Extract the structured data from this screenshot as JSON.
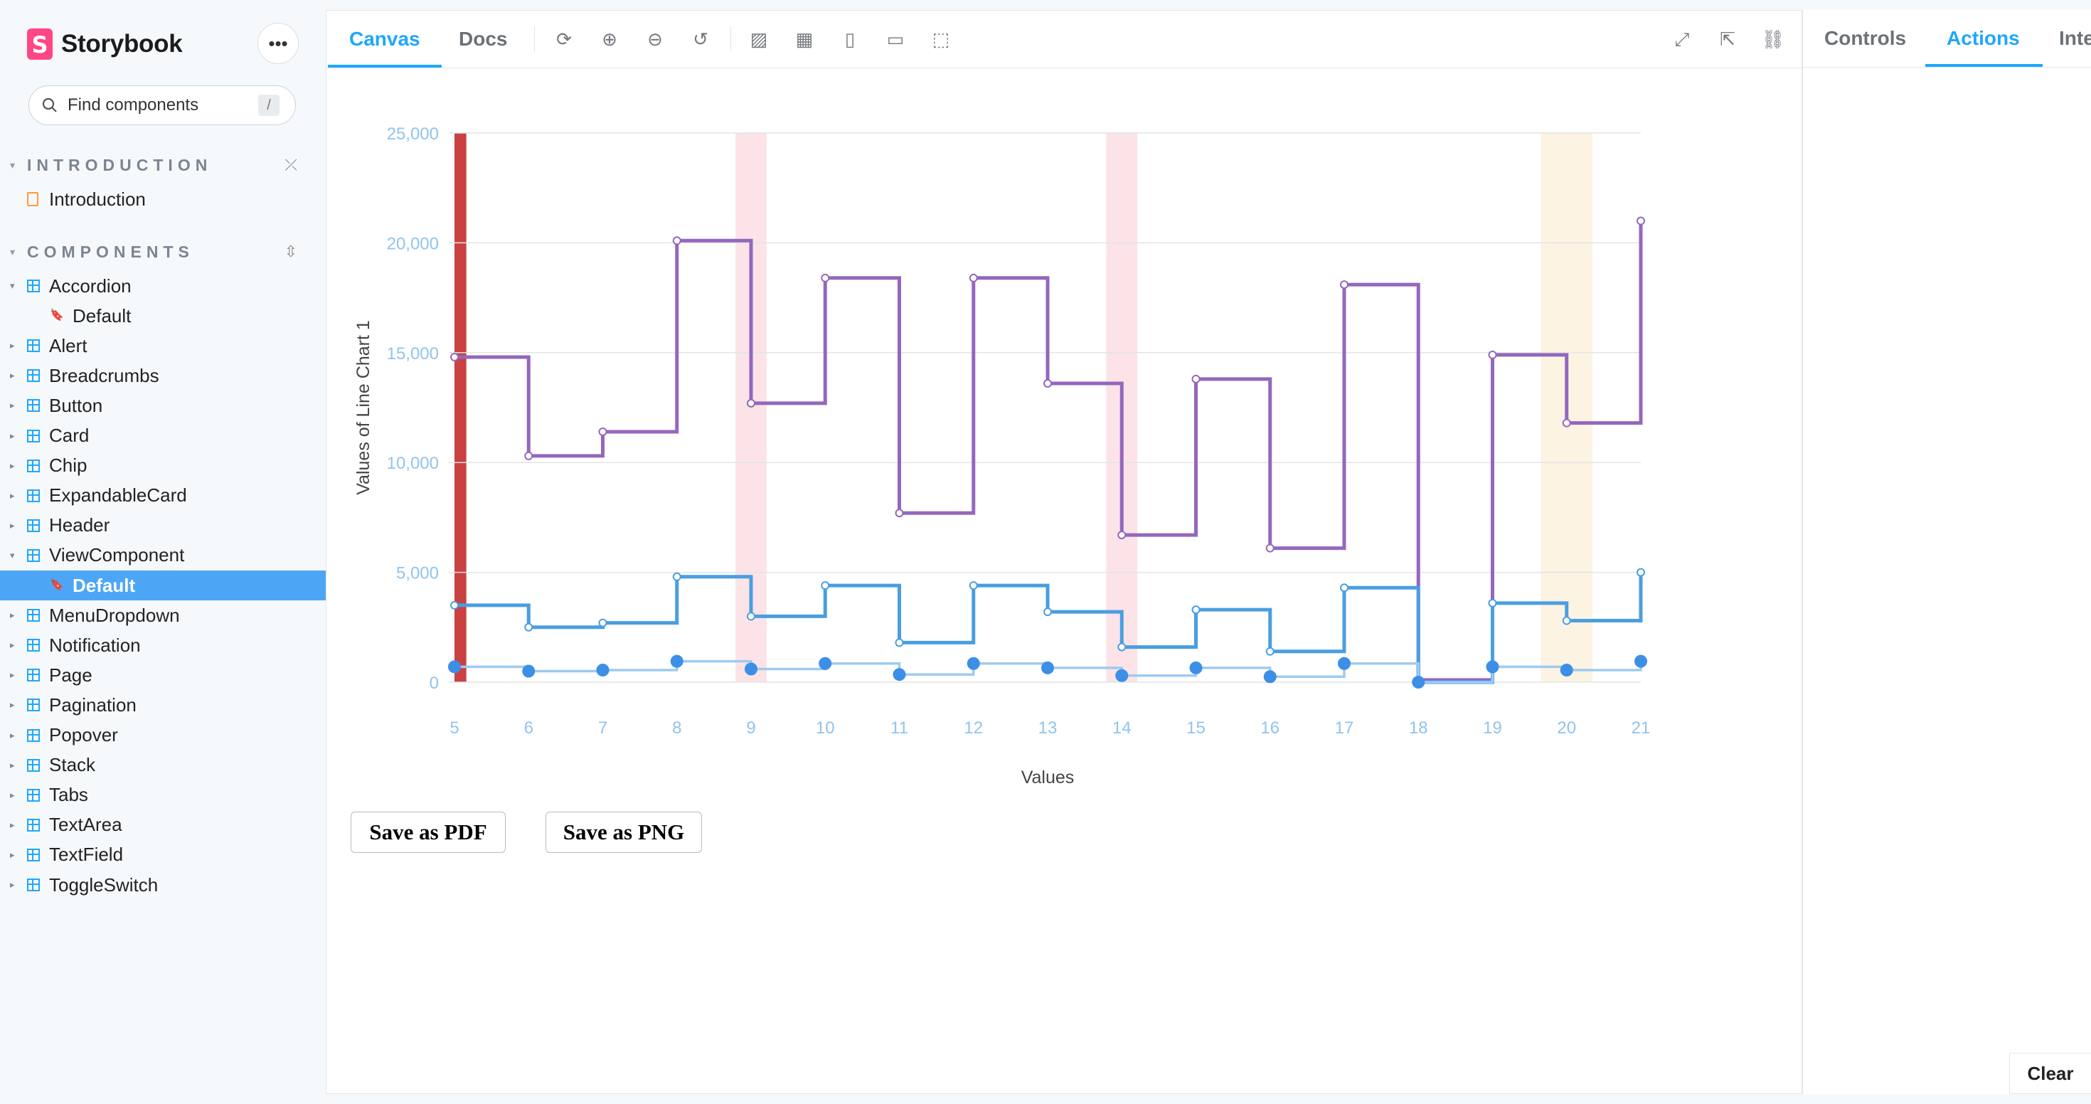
{
  "app": {
    "name": "Storybook",
    "logo_letter": "S"
  },
  "search": {
    "placeholder": "Find components",
    "shortcut": "/"
  },
  "sidebar": {
    "sections": [
      {
        "label": "INTRODUCTION"
      },
      {
        "label": "COMPONENTS"
      }
    ],
    "intro_item": "Introduction",
    "components": [
      "Accordion",
      "Default",
      "Alert",
      "Breadcrumbs",
      "Button",
      "Card",
      "Chip",
      "ExpandableCard",
      "Header",
      "ViewComponent",
      "Default",
      "MenuDropdown",
      "Notification",
      "Page",
      "Pagination",
      "Popover",
      "Stack",
      "Tabs",
      "TextArea",
      "TextField",
      "ToggleSwitch"
    ]
  },
  "toolbar": {
    "tab_canvas": "Canvas",
    "tab_docs": "Docs"
  },
  "addons": {
    "tab_controls": "Controls",
    "tab_actions": "Actions",
    "tab_interactions": "Interactions",
    "clear": "Clear"
  },
  "buttons": {
    "save_pdf": "Save as PDF",
    "save_png": "Save as PNG"
  },
  "chart_data": {
    "type": "line",
    "step": true,
    "xlabel": "Values",
    "ylabel": "Values of Line Chart 1",
    "x": [
      5,
      6,
      7,
      8,
      9,
      10,
      11,
      12,
      13,
      14,
      15,
      16,
      17,
      18,
      19,
      20,
      21
    ],
    "yticks": [
      0,
      5000,
      10000,
      15000,
      20000,
      25000
    ],
    "ytick_labels": [
      "0",
      "5,000",
      "10,000",
      "15,000",
      "20,000",
      "25,000"
    ],
    "ylim": [
      0,
      25000
    ],
    "series": [
      {
        "color": "#9467bd",
        "values": [
          14800,
          10300,
          11400,
          20100,
          12700,
          18400,
          7700,
          18400,
          13600,
          6700,
          13800,
          6100,
          18100,
          100,
          14900,
          11800,
          21000
        ]
      },
      {
        "color": "#4a9ee0",
        "values": [
          3500,
          2500,
          2700,
          4800,
          3000,
          4400,
          1800,
          4400,
          3200,
          1600,
          3300,
          1400,
          4300,
          0,
          3600,
          2800,
          5000
        ]
      },
      {
        "color": "#9ecbf0",
        "values": [
          700,
          500,
          550,
          950,
          600,
          850,
          350,
          850,
          650,
          300,
          650,
          250,
          850,
          0,
          700,
          550,
          950
        ]
      }
    ],
    "highlights": [
      {
        "x": 5,
        "color": "#c94141"
      },
      {
        "x": 9,
        "color": "#fbe3e8"
      },
      {
        "x": 14,
        "color": "#fbe3e8"
      },
      {
        "x": 20,
        "color": "#fdf3e3"
      }
    ],
    "grid": true
  }
}
